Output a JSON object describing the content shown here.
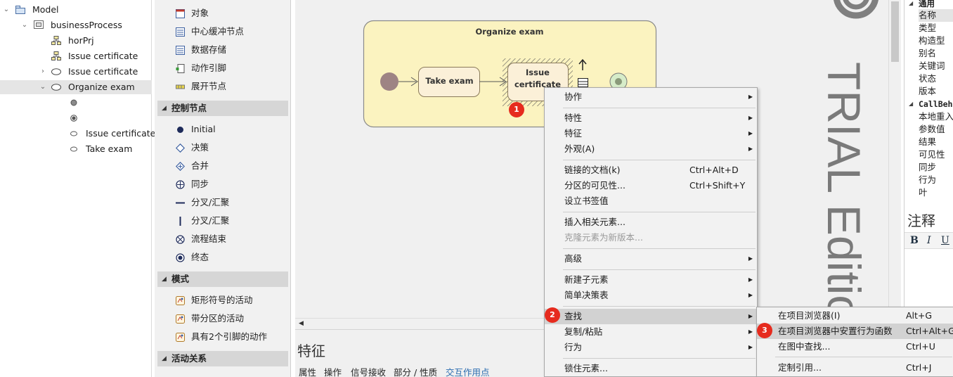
{
  "tree": {
    "items": [
      {
        "label": "Model",
        "toggle": "⌄",
        "icon": "package-icon"
      },
      {
        "label": "businessProcess",
        "toggle": "⌄",
        "icon": "activity-diagram-icon"
      },
      {
        "label": "horPrj",
        "toggle": "",
        "icon": "hierarchy-icon"
      },
      {
        "label": "Issue certificate",
        "toggle": "",
        "icon": "hierarchy-icon"
      },
      {
        "label": "Issue certificate",
        "toggle": "›",
        "icon": "activity-oval-icon"
      },
      {
        "label": "Organize exam",
        "toggle": "⌄",
        "icon": "activity-oval-icon"
      },
      {
        "label": "",
        "toggle": "",
        "icon": "initial-node-icon"
      },
      {
        "label": "",
        "toggle": "",
        "icon": "final-node-icon"
      },
      {
        "label": "Issue certificate",
        "toggle": "",
        "icon": "action-oval-icon"
      },
      {
        "label": "Take exam",
        "toggle": "",
        "icon": "action-oval-icon"
      }
    ]
  },
  "toolbox": {
    "top_items": [
      "对象",
      "中心缓冲节点",
      "数据存储",
      "动作引脚",
      "展开节点"
    ],
    "groups": [
      {
        "title": "控制节点",
        "items": [
          "Initial",
          "决策",
          "合并",
          "同步",
          "分叉/汇聚",
          "分叉/汇聚",
          "流程结束",
          "终态"
        ]
      },
      {
        "title": "模式",
        "items": [
          "矩形符号的活动",
          "带分区的活动",
          "具有2个引脚的动作"
        ]
      },
      {
        "title": "活动关系",
        "items": []
      }
    ]
  },
  "diagram": {
    "activity_title": "Organize exam",
    "take_exam": "Take exam",
    "issue_line1": "Issue",
    "issue_line2": "certificate"
  },
  "watermark": "TRIAL Editio",
  "features": {
    "title": "特征",
    "tabs": [
      "属性",
      "操作",
      "信号接收",
      "部分 / 性质",
      "交互作用点"
    ]
  },
  "properties": {
    "group1": "通用",
    "group1_rows": [
      "名称",
      "类型",
      "构造型",
      "别名",
      "关键词",
      "状态",
      "版本"
    ],
    "group2": "CallBeh",
    "group2_rows": [
      "本地重入",
      "参数值",
      "结果",
      "可见性",
      "同步",
      "行为",
      "叶"
    ]
  },
  "notes": {
    "title": "注释",
    "bold": "B",
    "italic": "I",
    "underline": "U"
  },
  "context_menu": {
    "items": [
      {
        "label": "协作",
        "shortcut": "",
        "arrow": true,
        "disabled": false,
        "highlight": false
      },
      {
        "sep": true
      },
      {
        "label": "特性",
        "shortcut": "",
        "arrow": true,
        "disabled": false,
        "highlight": false
      },
      {
        "label": "特征",
        "shortcut": "",
        "arrow": true,
        "disabled": false,
        "highlight": false
      },
      {
        "label": "外观(A)",
        "shortcut": "",
        "arrow": true,
        "disabled": false,
        "highlight": false
      },
      {
        "sep": true
      },
      {
        "label": "链接的文档(k)",
        "shortcut": "Ctrl+Alt+D",
        "arrow": false,
        "disabled": false,
        "highlight": false
      },
      {
        "label": "分区的可见性...",
        "shortcut": "Ctrl+Shift+Y",
        "arrow": false,
        "disabled": false,
        "highlight": false
      },
      {
        "label": "设立书签值",
        "shortcut": "",
        "arrow": false,
        "disabled": false,
        "highlight": false
      },
      {
        "sep": true
      },
      {
        "label": "插入相关元素...",
        "shortcut": "",
        "arrow": false,
        "disabled": false,
        "highlight": false
      },
      {
        "label": "克隆元素为新版本...",
        "shortcut": "",
        "arrow": false,
        "disabled": true,
        "highlight": false
      },
      {
        "sep": true
      },
      {
        "label": "高级",
        "shortcut": "",
        "arrow": true,
        "disabled": false,
        "highlight": false
      },
      {
        "sep": true
      },
      {
        "label": "新建子元素",
        "shortcut": "",
        "arrow": true,
        "disabled": false,
        "highlight": false
      },
      {
        "label": "简单决策表",
        "shortcut": "",
        "arrow": true,
        "disabled": false,
        "highlight": false
      },
      {
        "sep": true
      },
      {
        "label": "查找",
        "shortcut": "",
        "arrow": true,
        "disabled": false,
        "highlight": true
      },
      {
        "label": "复制/粘贴",
        "shortcut": "",
        "arrow": true,
        "disabled": false,
        "highlight": false
      },
      {
        "label": "行为",
        "shortcut": "",
        "arrow": true,
        "disabled": false,
        "highlight": false
      },
      {
        "sep": true
      },
      {
        "label": "锁住元素...",
        "shortcut": "",
        "arrow": false,
        "disabled": false,
        "highlight": false
      }
    ]
  },
  "submenu": {
    "items": [
      {
        "label": "在项目浏览器(I)",
        "shortcut": "Alt+G",
        "highlight": false
      },
      {
        "label": "在项目浏览器中安置行为函数",
        "shortcut": "Ctrl+Alt+G",
        "highlight": true
      },
      {
        "label": "在图中查找...",
        "shortcut": "Ctrl+U",
        "highlight": false
      },
      {
        "sep": true
      },
      {
        "label": "定制引用...",
        "shortcut": "Ctrl+J",
        "highlight": false
      }
    ]
  },
  "badges": [
    "1",
    "2",
    "3"
  ]
}
